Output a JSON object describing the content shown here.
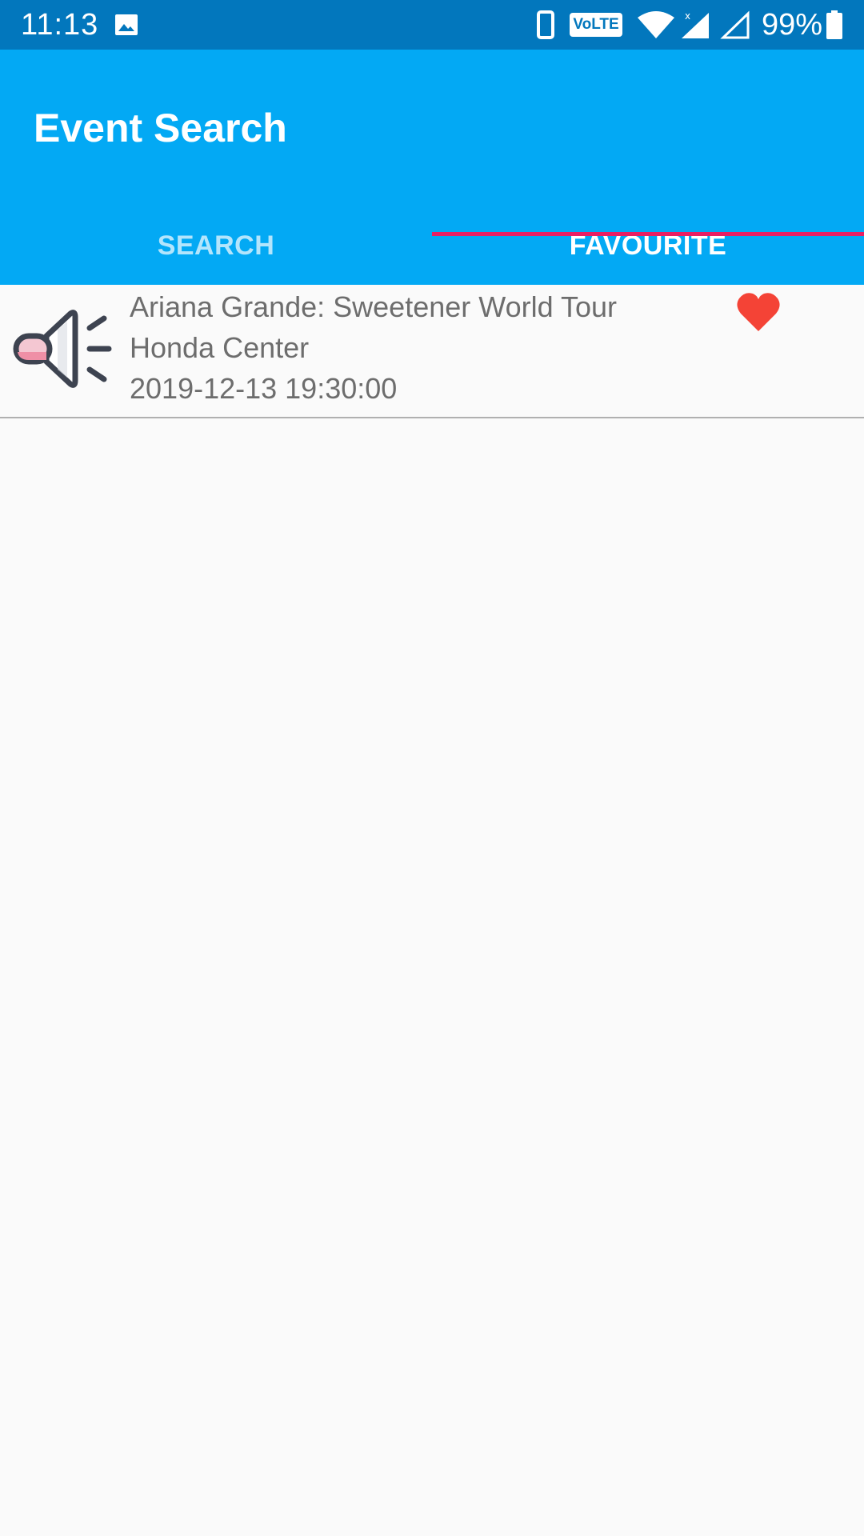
{
  "status_bar": {
    "time": "11:13",
    "volte": "VoLTE",
    "battery": "99%"
  },
  "app": {
    "title": "Event Search"
  },
  "tabs": [
    {
      "label": "SEARCH",
      "selected": false
    },
    {
      "label": "FAVOURITE",
      "selected": true
    }
  ],
  "favourites": [
    {
      "name": "Ariana Grande: Sweetener World Tour",
      "venue": "Honda Center",
      "datetime": "2019-12-13 19:30:00",
      "icon": "speaker-icon",
      "favourite": true
    }
  ],
  "colors": {
    "status_bar": "#0277bd",
    "app_bar": "#03a9f4",
    "tab_indicator": "#e91e63",
    "heart": "#f44336"
  }
}
